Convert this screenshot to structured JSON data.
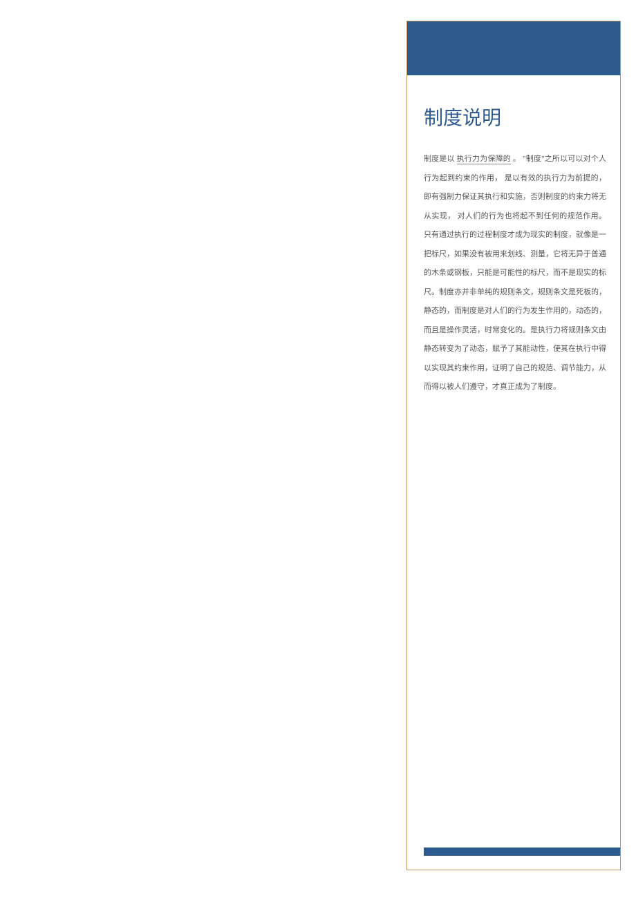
{
  "title": "制度说明",
  "body": {
    "prefix": "制度是以 ",
    "underlined": "执行力为保障的",
    "rest": "。 \"制度\"之所以可以对个人行为起到约束的作用，   是以有效的执行力为前提的，即有强制力保证其执行和实施，否则制度的约束力将无从实现，   对人们的行为也将起不到任何的规范作用。   只有通过执行的过程制度才成为现实的制度，就像是一把标尺，如果没有被用来划线、测量，它将无异于普通的木条或钢板，只能是可能性的标尺，而不是现实的标尺。制度亦并非单纯的规则条文，规则条文是死板的，静态的，而制度是对人们的行为发生作用的，动态的，而且是操作灵活，时常变化的。是执行力将规则条文由静态转变为了动态，赋予了其能动性，使其在执行中得以实现其约束作用，证明了自己的规范、调节能力，从而得以被人们遵守，才真正成为了制度。"
  }
}
